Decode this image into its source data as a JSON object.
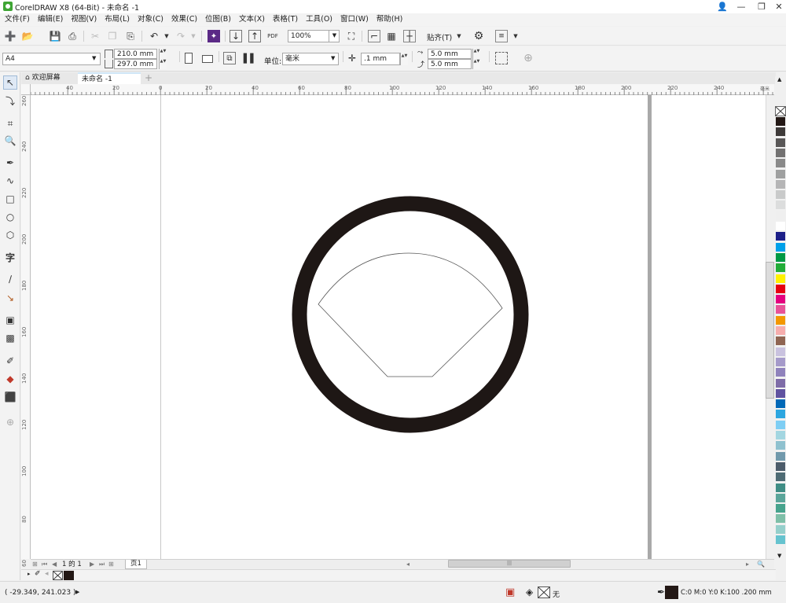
{
  "window": {
    "title": "CorelDRAW X8 (64-Bit) - 未命名 -1"
  },
  "menu": [
    "文件(F)",
    "编辑(E)",
    "视图(V)",
    "布局(L)",
    "对象(C)",
    "效果(C)",
    "位图(B)",
    "文本(X)",
    "表格(T)",
    "工具(O)",
    "窗口(W)",
    "帮助(H)"
  ],
  "toolbar": {
    "zoom": "100%",
    "pdf_label": "PDF",
    "snap_label": "贴齐(T)"
  },
  "property_bar": {
    "page_size": "A4",
    "width": "210.0 mm",
    "height": "297.0 mm",
    "unit_label": "单位:",
    "unit_value": "毫米",
    "nudge": ".1 mm",
    "dup_x": "5.0 mm",
    "dup_y": "5.0 mm"
  },
  "tabs": {
    "welcome": "欢迎屏幕",
    "document": "未命名 -1"
  },
  "ruler": {
    "top_labels": [
      "40",
      "20",
      "0",
      "20",
      "40",
      "60",
      "80",
      "100",
      "120",
      "140",
      "160",
      "180",
      "200",
      "220",
      "240"
    ],
    "top_unit": "毫米",
    "left_labels": [
      "260",
      "240",
      "220",
      "200",
      "180",
      "160",
      "140",
      "120",
      "100",
      "80",
      "60"
    ]
  },
  "page_nav": {
    "current": "1",
    "of": "的",
    "total": "1",
    "page_tab": "页1"
  },
  "status": {
    "coords": "( -29.349, 241.023 )",
    "fill": "无",
    "outline": "C:0 M:0 Y:0 K:100  .200 mm"
  },
  "colors": {
    "ring": "#1e1715",
    "accent": "#3fa535"
  },
  "palette": [
    "#231815",
    "#3e3a39",
    "#595757",
    "#727171",
    "#898989",
    "#9fa0a0",
    "#b5b5b6",
    "#c9caca",
    "#dcdddd",
    "#efefef",
    "#ffffff",
    "#1d2088",
    "#00a0e9",
    "#009944",
    "#22ac38",
    "#fff100",
    "#e60012",
    "#e4007f",
    "#e85298",
    "#f39800",
    "#f6adad",
    "#8f6552",
    "#c9c2df",
    "#a59aca",
    "#8f82bc",
    "#7e6ca8",
    "#5f52a0",
    "#0068b7",
    "#2ca6e0",
    "#7ecef4",
    "#a3d6e1",
    "#8fc1cf",
    "#7199ac",
    "#4c5c6a",
    "#4e6b74",
    "#3f8d85",
    "#5aa59a",
    "#47a38d",
    "#7ebfa8",
    "#95cfcb",
    "#66c3cf"
  ]
}
